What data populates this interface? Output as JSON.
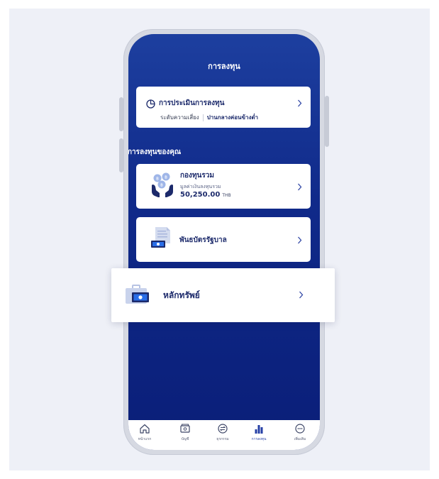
{
  "screen": {
    "title": "การลงทุน"
  },
  "risk_card": {
    "title": "การประเมินการลงทุน",
    "label": "ระดับความเสี่ยง",
    "value": "ปานกลางค่อนข้างต่ำ"
  },
  "section_label": "การลงทุนของคุณ",
  "fund_card": {
    "title": "กองทุนรวม",
    "label": "มูลค่าเงินลงทุนรวม",
    "amount": "50,250.00",
    "currency": "THB"
  },
  "bond_card": {
    "title": "พันธบัตรรัฐบาล"
  },
  "securities_card": {
    "title": "หลักทรัพย์"
  },
  "tabbar": {
    "items": [
      {
        "label": "หน้าแรก",
        "icon": "home-icon"
      },
      {
        "label": "บัญชี",
        "icon": "wallet-icon"
      },
      {
        "label": "ธุรกรรม",
        "icon": "transfer-icon"
      },
      {
        "label": "การลงทุน",
        "icon": "bar-chart-icon",
        "active": true
      },
      {
        "label": "เพิ่มเติม",
        "icon": "more-icon"
      }
    ]
  },
  "colors": {
    "primary": "#253fa5",
    "navy_top": "#1d3f9f",
    "navy_bottom": "#0a1e78",
    "text_dark": "#1c2a6b",
    "bill_green": "#2a6ee8",
    "background": "#eef0f7"
  }
}
